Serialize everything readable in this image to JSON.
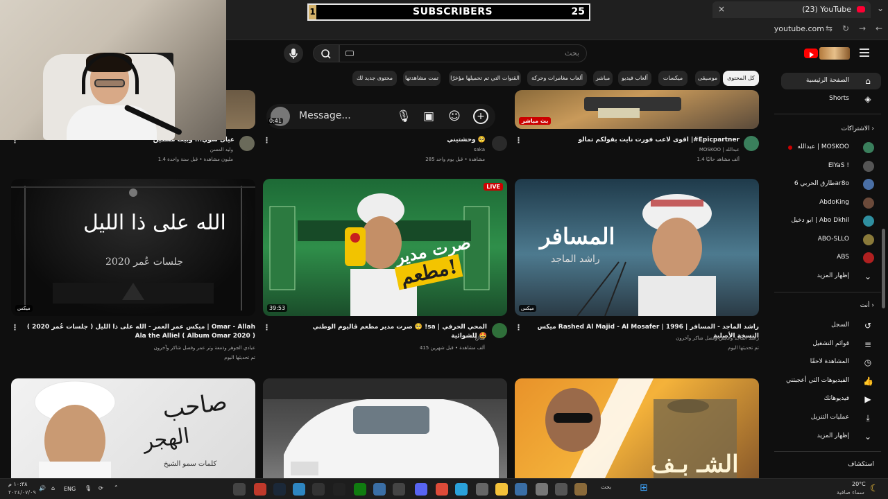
{
  "browser": {
    "tab_title": "(23) YouTube",
    "url": "youtube.com",
    "new_tab_icon": "+",
    "close_icon": "×"
  },
  "overlay": {
    "bar_value": "1",
    "label": "SUBSCRIBERS",
    "count": "25"
  },
  "masthead": {
    "search_placeholder": "بحث"
  },
  "chips": [
    "كل المحتوى",
    "موسيقى",
    "ميكسات",
    "ألعاب فيديو",
    "مباشر",
    "ألعاب مغامرات وحركة",
    "القنوات التي تم تحميلها مؤخرًا",
    "تمت مشاهدتها",
    "محتوى جديد لك"
  ],
  "sidebar": {
    "home": "الصفحة الرئيسية",
    "shorts": "Shorts",
    "subscriptions_heading": "الاشتراكات",
    "subscriptions": [
      {
        "name": "عبدالله | MOSKOO",
        "color": "#3a7f5c"
      },
      {
        "name": "ElYaS !",
        "color": "#555555"
      },
      {
        "name": "طارق الحربي 6ar8o",
        "color": "#4a6fa5"
      },
      {
        "name": "AbdoKing",
        "color": "#6b4a3a"
      },
      {
        "name": "ابو دخيل | Abo Dkhil",
        "color": "#2f8fa0"
      },
      {
        "name": "ABO-SLLO",
        "color": "#8a7a3a"
      },
      {
        "name": "ABS",
        "color": "#b02020"
      }
    ],
    "show_more": "إظهار المزيد",
    "you_heading": "أنت",
    "you_items": [
      {
        "label": "السجل",
        "icon": "history-icon"
      },
      {
        "label": "قوائم التشغيل",
        "icon": "playlists-icon"
      },
      {
        "label": "المشاهدة لاحقًا",
        "icon": "watch-later-icon"
      },
      {
        "label": "الفيديوهات التي أعجبتني",
        "icon": "like-icon"
      },
      {
        "label": "فيديوهاتك",
        "icon": "your-videos-icon"
      },
      {
        "label": "عمليات التنزيل",
        "icon": "download-icon"
      }
    ],
    "show_more_2": "إظهار المزيد",
    "explore_heading": "استكشاف"
  },
  "message_bar": {
    "timer": "0:41",
    "placeholder": "Message..."
  },
  "row1": [
    {
      "title": "عيال سوي... وبيت مسكين",
      "channel": "وليد المسن",
      "meta": "1.4 مليون مشاهدة • قبل سنة واحدة"
    },
    {
      "title": "وحشتيني 🥺",
      "channel": "saka",
      "meta": "285 مشاهدة • قبل يوم واحد"
    },
    {
      "title": "اقوى لاعب فورت نايت بقولكم تمالو |#Epicpartner",
      "channel": "MOSKOO | عبدالله",
      "meta": "1.4 ألف مشاهد حاليًا",
      "live_badge": "بث مباشر"
    }
  ],
  "row2": [
    {
      "title": "ميكس عمر العمر - الله على ذا الليل ( جلسات عُمر 2020 ) | Omar - Allah Ala the Alliel ( Album Omar 2020 )",
      "channel": "عبادي الجوهر وذمعة وتر عمر وفصل شاكر وآخرون",
      "meta": "تم تحديثها اليوم",
      "thumb_line1": "الله على ذا الليل",
      "thumb_line2": "جلسات عُمر 2020",
      "badge": "ميكس"
    },
    {
      "title": "صرت مدير مطعم ڤاليوم الوطني 🥺 !sa | المحي الحرفي للشوائية 🤩",
      "channel": "سالح",
      "meta": "415 ألف مشاهدة • قبل شهرين",
      "duration": "39:53",
      "live": "LIVE",
      "thumb_line1": "صرت مدير",
      "thumb_line2": "مطعم!"
    },
    {
      "title": "ميكس Rashed Al Majid - Al Mosafer | 1996 راشد الماجد - المسافر | النسخة الأصلية",
      "channel": "راشد الماجد وعايض وفصل شاكر وآخرون",
      "meta": "تم تحديثها اليوم",
      "thumb_line1": "المسافر",
      "thumb_line2": "راشد الماجد",
      "badge": "ميكس"
    }
  ],
  "row3": [
    {
      "thumb_line1": "صاحب",
      "thumb_line2": "الهجر",
      "thumb_line3": "كلمات سمو الشيخ"
    },
    {},
    {
      "thumb_line1": "الشـ بـف"
    }
  ],
  "taskbar": {
    "time": "١٠:٣٨ م",
    "date": "٢٠٢٤/٠٧/٠٩",
    "lang": "ENG",
    "weather_temp": "20°C",
    "weather_desc": "سماء صافية",
    "search": "بحث"
  }
}
